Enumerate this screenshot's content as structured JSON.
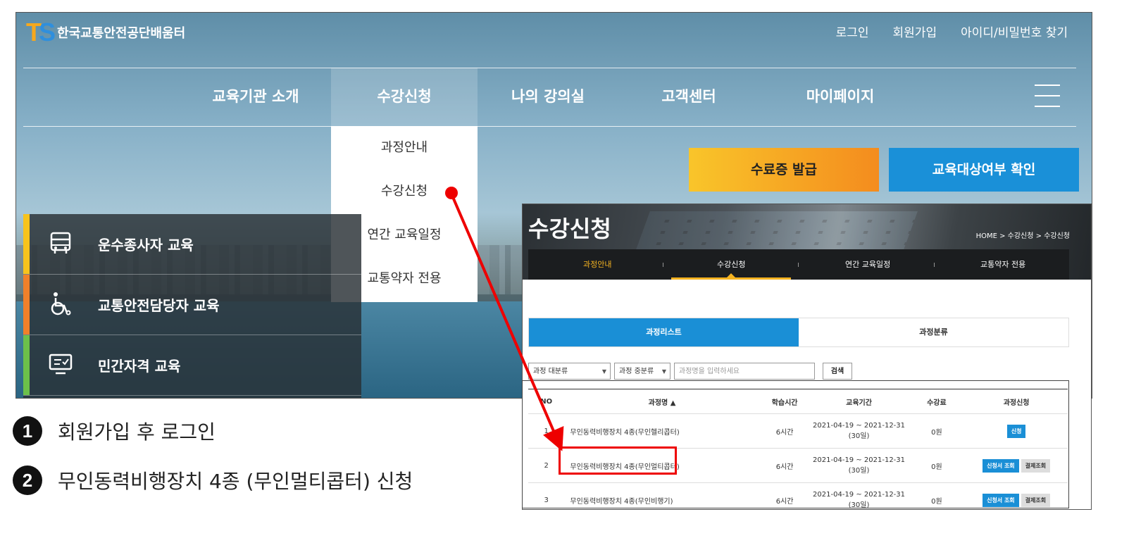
{
  "site": {
    "logo_mark_t": "T",
    "logo_mark_s": "S",
    "logo_name": "한국교통안전공단배움터",
    "top_links": [
      "로그인",
      "회원가입",
      "아이디/비밀번호 찾기"
    ],
    "gnb": [
      "교육기관 소개",
      "수강신청",
      "나의 강의실",
      "고객센터",
      "마이페이지"
    ],
    "dropdown": [
      "과정안내",
      "수강신청",
      "연간 교육일정",
      "교통약자 전용"
    ],
    "btn_cert": "수료증 발급",
    "btn_check": "교육대상여부 확인",
    "categories": [
      "운수종사자 교육",
      "교통안전담당자 교육",
      "민간자격 교육"
    ],
    "category_colors": [
      "#f7c31c",
      "#f0802a",
      "#6cc04a"
    ]
  },
  "steps": [
    {
      "num": "1",
      "text": "회원가입 후 로그인"
    },
    {
      "num": "2",
      "text": "무인동력비행장치 4종 (무인멀티콥터) 신청"
    }
  ],
  "inset": {
    "title": "수강신청",
    "breadcrumb": "HOME  >  수강신청  >  수강신청",
    "subnav": [
      "과정안내",
      "수강신청",
      "연간 교육일정",
      "교통약자 전용"
    ],
    "tabs": [
      "과정리스트",
      "과정분류"
    ],
    "filter1": "과정 대분류",
    "filter2": "과정 중분류",
    "search_placeholder": "과정명을 입력하세요",
    "search_btn": "검색",
    "headers": [
      "NO",
      "과정명 ▲",
      "학습시간",
      "교육기간",
      "수강료",
      "과정신청"
    ],
    "rows": [
      {
        "no": "1",
        "name": "무인동력비행장치 4종(무인헬리콥터)",
        "hours": "6시간",
        "period1": "2021-04-19 ~ 2021-12-31",
        "period2": "(30일)",
        "fee": "0원",
        "btn1": "신청",
        "btn2": ""
      },
      {
        "no": "2",
        "name": "무인동력비행장치 4종(무인멀티콥터)",
        "hours": "6시간",
        "period1": "2021-04-19 ~ 2021-12-31",
        "period2": "(30일)",
        "fee": "0원",
        "btn1": "신청서 조회",
        "btn2": "결제조회"
      },
      {
        "no": "3",
        "name": "무인동력비행장치 4종(무인비행기)",
        "hours": "6시간",
        "period1": "2021-04-19 ~ 2021-12-31",
        "period2": "(30일)",
        "fee": "0원",
        "btn1": "신청서 조회",
        "btn2": "결제조회"
      }
    ]
  }
}
